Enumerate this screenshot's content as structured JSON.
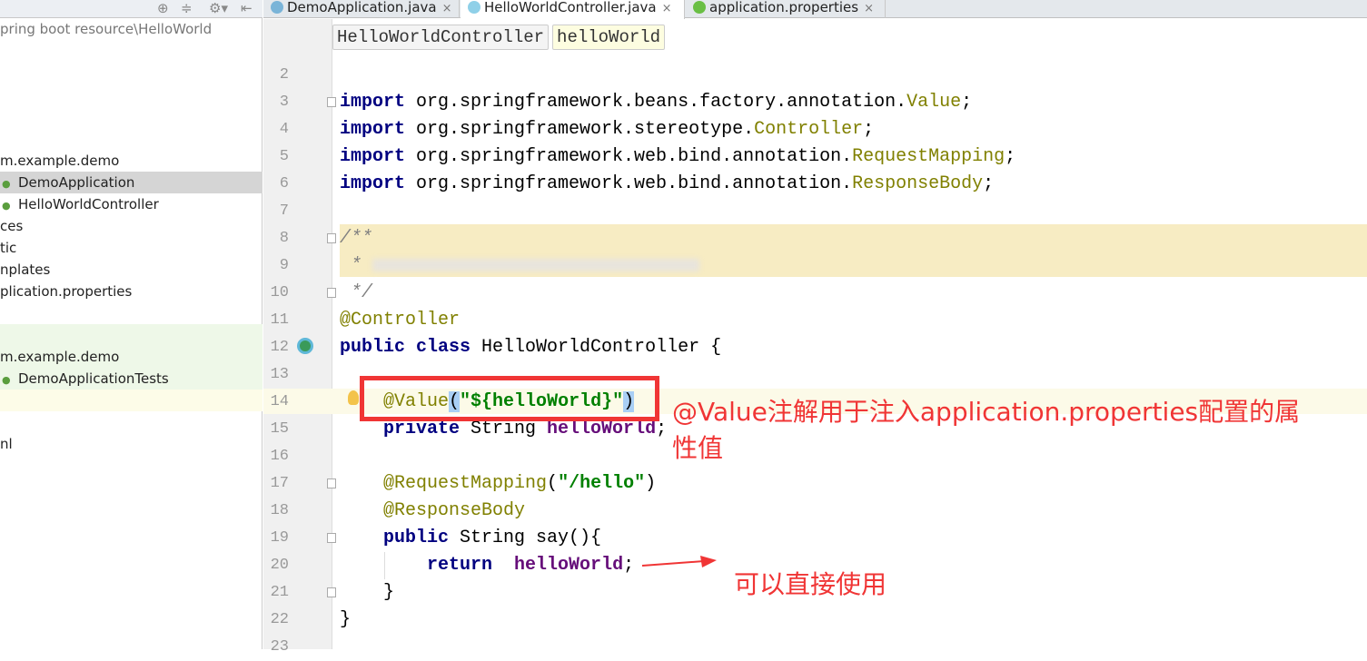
{
  "sidebar": {
    "toolbar_icons": [
      "target-icon",
      "collapse-icon",
      "gear-icon",
      "hide-icon"
    ],
    "path": "pring boot resource\\HelloWorld",
    "items": [
      {
        "label": "m.example.demo",
        "icon": ""
      },
      {
        "label": "DemoApplication",
        "icon": "class-icon",
        "selected": true
      },
      {
        "label": "HelloWorldController",
        "icon": "class-icon"
      },
      {
        "label": "ces",
        "icon": ""
      },
      {
        "label": "tic",
        "icon": ""
      },
      {
        "label": "nplates",
        "icon": ""
      },
      {
        "label": "plication.properties",
        "icon": ""
      },
      {
        "label": "m.example.demo",
        "icon": ""
      },
      {
        "label": "DemoApplicationTests",
        "icon": "class-icon"
      },
      {
        "label": "nl",
        "icon": ""
      }
    ]
  },
  "tabs": [
    {
      "label": "DemoApplication.java",
      "icon": "spring-boot-icon",
      "active": false
    },
    {
      "label": "HelloWorldController.java",
      "icon": "class-icon",
      "active": true
    },
    {
      "label": "application.properties",
      "icon": "properties-icon",
      "active": false
    }
  ],
  "tab_close": "×",
  "breadcrumbs": [
    "HelloWorldController",
    "helloWorld"
  ],
  "code": {
    "line_numbers": [
      "2",
      "3",
      "4",
      "5",
      "6",
      "7",
      "8",
      "9",
      "10",
      "11",
      "12",
      "13",
      "14",
      "15",
      "16",
      "17",
      "18",
      "19",
      "20",
      "21",
      "22",
      "23"
    ],
    "l3": [
      "import",
      " org.springframework.beans.factory.annotation.",
      "Value",
      ";"
    ],
    "l4": [
      "import",
      " org.springframework.stereotype.",
      "Controller",
      ";"
    ],
    "l5": [
      "import",
      " org.springframework.web.bind.annotation.",
      "RequestMapping",
      ";"
    ],
    "l6": [
      "import",
      " org.springframework.web.bind.annotation.",
      "ResponseBody",
      ";"
    ],
    "l8": "/**",
    "l9": " *",
    "l10": " */",
    "l11": "@Controller",
    "l12": [
      "public class",
      " HelloWorldController {"
    ],
    "l14": [
      "    @Value",
      "(",
      "\"${helloWorld}\"",
      ")"
    ],
    "l15": [
      "    private",
      " String ",
      "helloWorld",
      ";"
    ],
    "l17": [
      "    @RequestMapping",
      "(",
      "\"/hello\"",
      ")"
    ],
    "l18": "    @ResponseBody",
    "l19": [
      "    public",
      " String say(){"
    ],
    "l20": [
      "        return",
      "  ",
      "helloWorld",
      ";"
    ],
    "l21": "    }",
    "l22": "}"
  },
  "annotations": {
    "value_note_line1": "@Value注解用于注入application.properties配置的属",
    "value_note_line2": "性值",
    "return_note": "可以直接使用",
    "color": "#f03535"
  }
}
